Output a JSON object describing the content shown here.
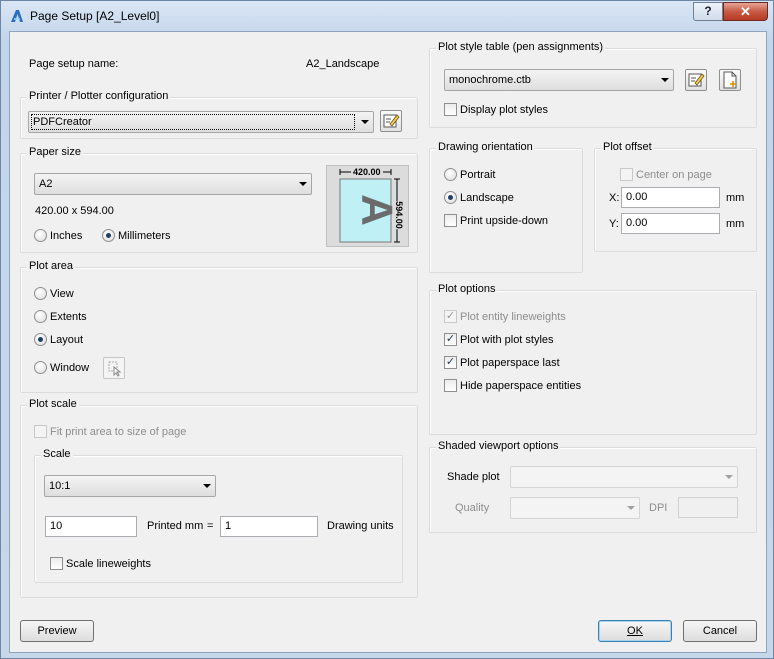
{
  "window": {
    "title": "Page Setup [A2_Level0]",
    "help": "?",
    "close": "✕"
  },
  "page_setup": {
    "name_label": "Page setup name:",
    "name_value": "A2_Landscape"
  },
  "printer": {
    "group_label": "Printer / Plotter configuration",
    "selected": "PDFCreator"
  },
  "paper": {
    "group_label": "Paper size",
    "selected": "A2",
    "dimensions": "420.00 x 594.00",
    "units": [
      {
        "label": "Inches",
        "checked": false
      },
      {
        "label": "Millimeters",
        "checked": true
      }
    ],
    "preview": {
      "width_label": "420.00",
      "height_label": "594.00",
      "letter": "A"
    }
  },
  "plot_area": {
    "group_label": "Plot area",
    "options": [
      {
        "label": "View",
        "checked": false
      },
      {
        "label": "Extents",
        "checked": false
      },
      {
        "label": "Layout",
        "checked": true
      },
      {
        "label": "Window",
        "checked": false
      }
    ]
  },
  "plot_scale": {
    "group_label": "Plot scale",
    "fit_label": "Fit print area to size of page",
    "scale_label": "Scale",
    "scale_selected": "10:1",
    "printed_value": "10",
    "printed_label": "Printed mm",
    "equals": "=",
    "units_value": "1",
    "units_label": "Drawing units",
    "lineweights_label": "Scale lineweights"
  },
  "plot_style": {
    "group_label": "Plot style table (pen assignments)",
    "selected": "monochrome.ctb",
    "display_label": "Display plot styles"
  },
  "orientation": {
    "group_label": "Drawing orientation",
    "options": [
      {
        "label": "Portrait",
        "checked": false
      },
      {
        "label": "Landscape",
        "checked": true
      }
    ],
    "upside_down_label": "Print upside-down"
  },
  "plot_offset": {
    "group_label": "Plot offset",
    "center_label": "Center on page",
    "x_label": "X:",
    "x_value": "0.00",
    "x_unit": "mm",
    "y_label": "Y:",
    "y_value": "0.00",
    "y_unit": "mm"
  },
  "plot_options": {
    "group_label": "Plot options",
    "items": [
      {
        "label": "Plot entity lineweights",
        "checked": true,
        "disabled": true
      },
      {
        "label": "Plot with plot styles",
        "checked": true,
        "disabled": false
      },
      {
        "label": "Plot paperspace last",
        "checked": true,
        "disabled": false
      },
      {
        "label": "Hide paperspace entities",
        "checked": false,
        "disabled": false
      }
    ]
  },
  "shaded": {
    "group_label": "Shaded viewport options",
    "shade_label": "Shade plot",
    "quality_label": "Quality",
    "dpi_label": "DPI"
  },
  "buttons": {
    "preview": "Preview",
    "ok": "OK",
    "cancel": "Cancel"
  },
  "colors": {
    "accent": "#3c7fb1",
    "preview_paper": "#bff0f5",
    "preview_letter": "#6b6b6b"
  }
}
